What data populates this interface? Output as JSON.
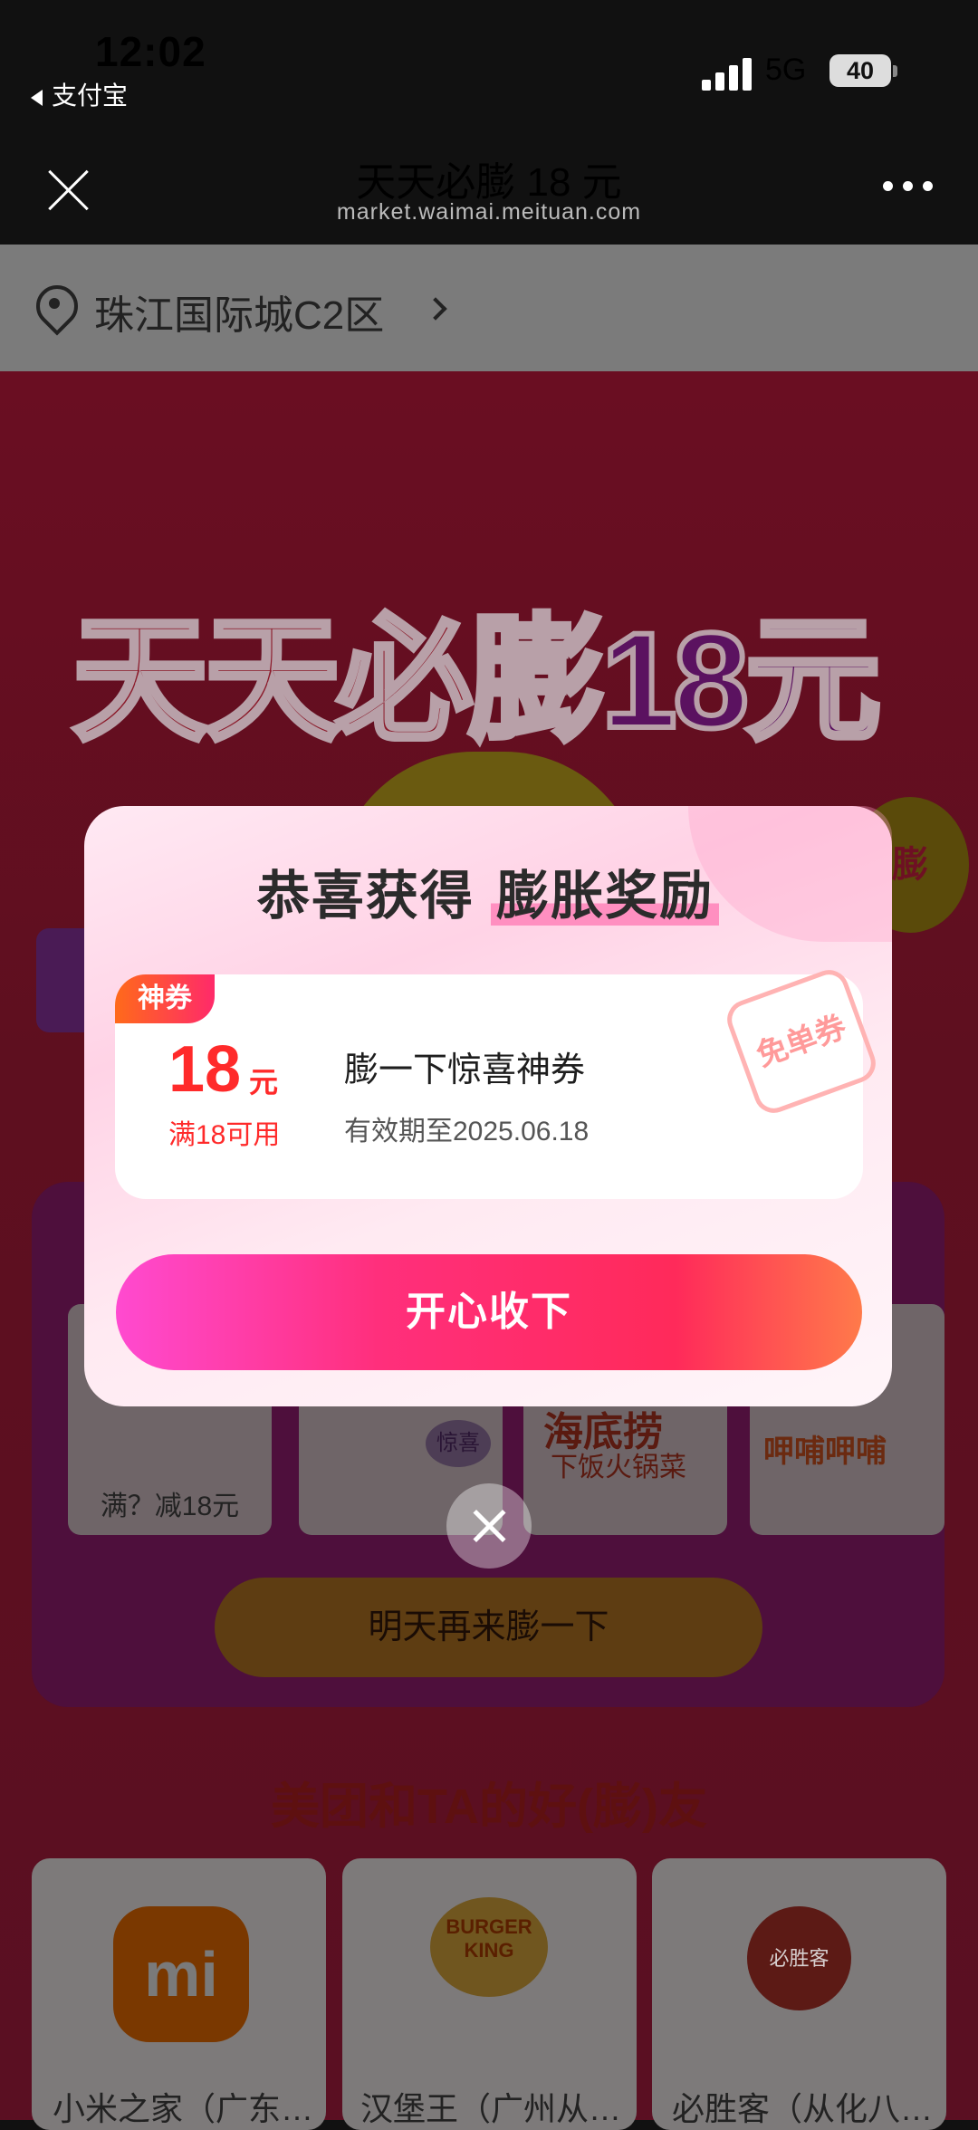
{
  "status_bar": {
    "time": "12:02",
    "back_app": "支付宝",
    "network": "5G",
    "battery": "40"
  },
  "nav": {
    "title": "天天必膨 18 元",
    "url": "market.waimai.meituan.com"
  },
  "location": {
    "text": "珠江国际城C2区"
  },
  "hero": {
    "title_main": "天天必膨",
    "title_accent": "18元",
    "badge": "膨"
  },
  "shops": {
    "shop1_label": "满？减18元",
    "shop3_brand": "海底捞",
    "shop3_sub": "下饭火锅菜",
    "shop4_brand": "呷哺呷哺",
    "surprise_tag": "惊喜"
  },
  "tomorrow_button": "明天再来膨一下",
  "friends": {
    "title": "美团和TA的好(膨)友",
    "items": [
      {
        "name": "小米之家（广东…",
        "logo": "mi"
      },
      {
        "name": "汉堡王（广州从…",
        "logo": "BURGER KING"
      },
      {
        "name": "必胜客（从化八…",
        "logo": "必胜客"
      }
    ]
  },
  "modal": {
    "title_prefix": "恭喜获得",
    "title_highlight": "膨胀奖励",
    "coupon": {
      "tag": "神券",
      "amount": "18",
      "unit": "元",
      "condition": "满18可用",
      "name": "膨一下惊喜神券",
      "validity": "有效期至2025.06.18",
      "stamp": "免单券"
    },
    "accept_button": "开心收下"
  },
  "colors": {
    "accent_pink": "#ff2f7c",
    "coupon_red": "#ff2a2a",
    "modal_bg": "#ffe9f3"
  }
}
